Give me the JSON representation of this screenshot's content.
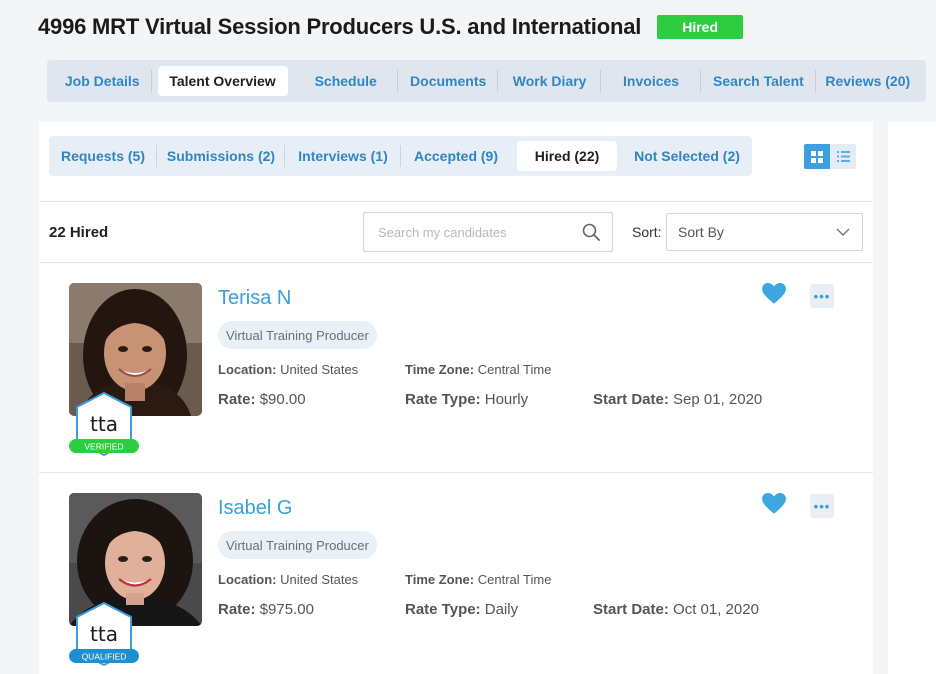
{
  "job": {
    "title": "4996 MRT Virtual Session Producers U.S. and International",
    "status": "Hired"
  },
  "main_tabs": [
    {
      "label": "Job Details"
    },
    {
      "label": "Talent Overview",
      "active": true
    },
    {
      "label": "Schedule"
    },
    {
      "label": "Documents"
    },
    {
      "label": "Work Diary"
    },
    {
      "label": "Invoices"
    },
    {
      "label": "Search Talent"
    },
    {
      "label": "Reviews (20)"
    }
  ],
  "sub_tabs": [
    {
      "label": "Requests (5)"
    },
    {
      "label": "Submissions (2)"
    },
    {
      "label": "Interviews (1)"
    },
    {
      "label": "Accepted (9)"
    },
    {
      "label": "Hired (22)",
      "active": true
    },
    {
      "label": "Not Selected (2)"
    }
  ],
  "view_toggle": {
    "grid_icon": "grid-icon",
    "list_icon": "list-icon",
    "selected": "grid"
  },
  "results": {
    "count_label": "22 Hired",
    "search_placeholder": "Search my candidates",
    "sort_label": "Sort:",
    "sort_value": "Sort By"
  },
  "labels": {
    "location": "Location:",
    "time_zone": "Time Zone:",
    "rate": "Rate:",
    "rate_type": "Rate Type:",
    "start_date": "Start Date:"
  },
  "candidates": [
    {
      "name": "Terisa N",
      "role": "Virtual Training Producer",
      "location": "United States",
      "time_zone": "Central Time",
      "rate": "$90.00",
      "rate_type": "Hourly",
      "start_date": "Sep 01, 2020",
      "badge_text": "VERIFIED",
      "badge_logo": "tta",
      "badge_color": "#2ecc40",
      "favorited": true
    },
    {
      "name": "Isabel G",
      "role": "Virtual Training Producer",
      "location": "United States",
      "time_zone": "Central Time",
      "rate": "$975.00",
      "rate_type": "Daily",
      "start_date": "Oct 01, 2020",
      "badge_text": "QUALIFIED",
      "badge_logo": "tta",
      "badge_color": "#1e8fd0",
      "favorited": true
    }
  ],
  "colors": {
    "accent": "#3a9fd8",
    "hired_badge": "#2ecc40",
    "tab_link": "#2f86c4"
  }
}
